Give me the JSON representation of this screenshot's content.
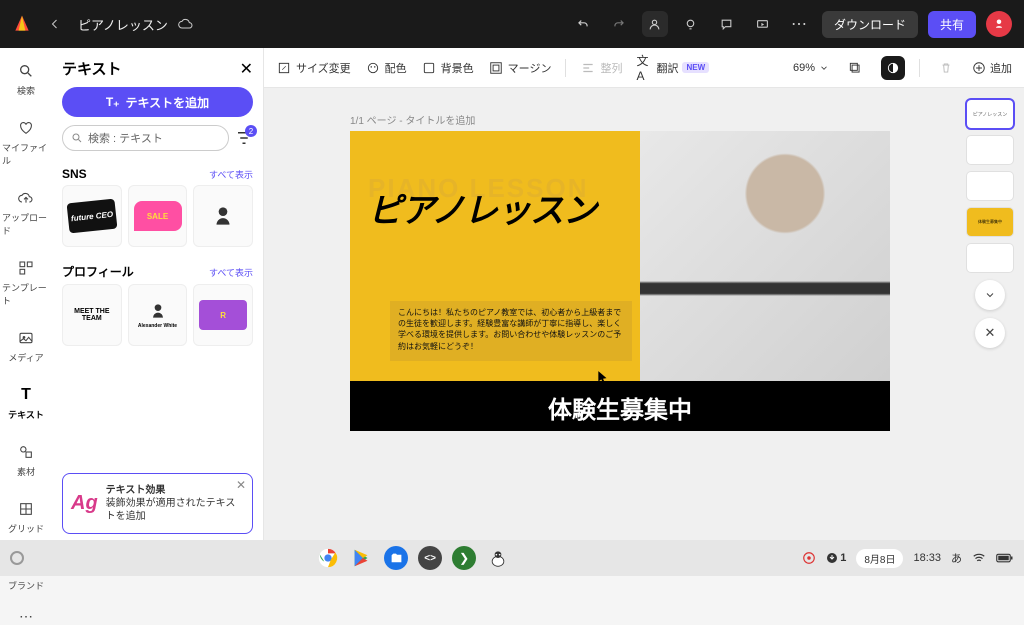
{
  "topbar": {
    "doc_title": "ピアノレッスン",
    "download": "ダウンロード",
    "share": "共有"
  },
  "rail": {
    "search": "検索",
    "myfile": "マイファイル",
    "upload": "アップロード",
    "template": "テンプレート",
    "media": "メディア",
    "text": "テキスト",
    "element": "素材",
    "grid": "グリッド",
    "brand": "ブランド"
  },
  "panel": {
    "title": "テキスト",
    "add_text": "テキストを追加",
    "search_label": "検索 : テキスト",
    "filter_count": "2",
    "sec1": "SNS",
    "sec2": "プロフィール",
    "see_all": "すべて表示",
    "thumb_sns_1": "future CEO",
    "thumb_prof_1a": "MEET THE",
    "thumb_prof_1b": "TEAM",
    "thumb_prof_2": "Alexander White",
    "effect_title": "テキスト効果",
    "effect_body": "装飾効果が適用されたテキストを追加"
  },
  "tb": {
    "resize": "サイズ変更",
    "palette": "配色",
    "bgcolor": "背景色",
    "margin": "マージン",
    "align": "整列",
    "translate": "翻訳",
    "new": "NEW",
    "zoom": "69%",
    "add": "追加"
  },
  "canvas": {
    "page_label": "1/1 ページ - タイトルを追加",
    "eng_title": "PIANO LESSON",
    "jp_title": "ピアノレッスン",
    "body": "こんにちは！私たちのピアノ教室では、初心者から上級者までの生徒を歓迎します。経験豊富な講師が丁寧に指導し、楽しく学べる環境を提供します。お問い合わせや体験レッスンのご予約はお気軽にどうぞ！",
    "recruit": "体験生募集中"
  },
  "pages": [
    "ピアノレッスン",
    "",
    "",
    "体験生募集中",
    ""
  ],
  "taskbar": {
    "date": "8月8日",
    "time": "18:33",
    "ime": "あ"
  }
}
